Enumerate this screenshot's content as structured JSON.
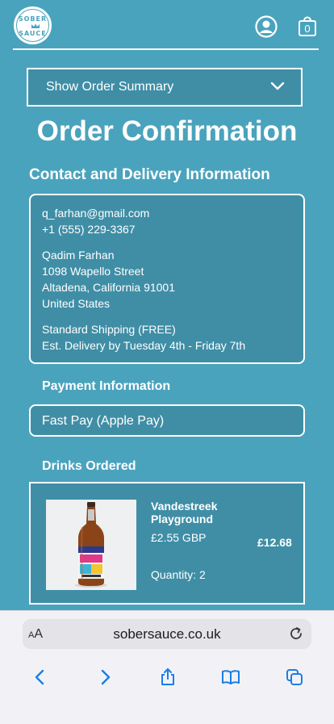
{
  "header": {
    "logo_top_text": "SOBER",
    "logo_bottom_text": "SAUCE",
    "cart_count": "0"
  },
  "summary": {
    "toggle_label": "Show Order Summary"
  },
  "page": {
    "title": "Order Confirmation",
    "contact_heading": "Contact and Delivery Information"
  },
  "contact": {
    "email": "q_farhan@gmail.com",
    "phone": "+1 (555) 229-3367",
    "name": "Qadim Farhan",
    "street": "1098 Wapello Street",
    "city_line": "Altadena, California 91001",
    "country": "United States",
    "shipping_method": "Standard Shipping (FREE)",
    "delivery_estimate": "Est. Delivery by Tuesday 4th - Friday 7th"
  },
  "payment": {
    "heading": "Payment Information",
    "method": "Fast Pay (Apple Pay)"
  },
  "drinks": {
    "heading": "Drinks Ordered",
    "items": [
      {
        "name": "Vandestreek Playground",
        "price": "£2.55 GBP",
        "quantity_label": "Quantity:",
        "quantity": "2",
        "total": "£12.68"
      }
    ]
  },
  "browser": {
    "aa_small": "A",
    "aa_large": "A",
    "url": "sobersauce.co.uk"
  },
  "colors": {
    "background": "#4aa3bd",
    "card": "#3f8ea6",
    "accent": "#1a7ee6"
  }
}
